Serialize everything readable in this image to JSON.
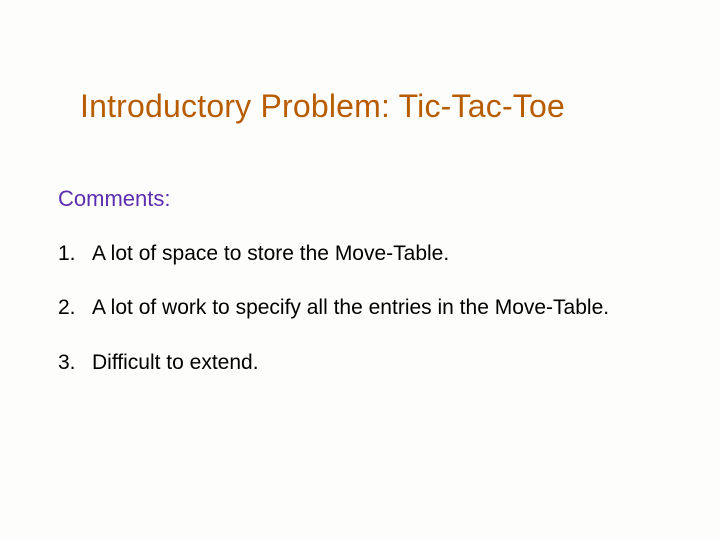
{
  "slide": {
    "title": "Introductory Problem: Tic-Tac-Toe",
    "subheading": "Comments:",
    "items": [
      {
        "num": "1.",
        "text": "A lot of space to store the Move-Table."
      },
      {
        "num": "2.",
        "text": "A lot of work to specify all the entries in the Move-Table."
      },
      {
        "num": "3.",
        "text": "Difficult to extend."
      }
    ]
  }
}
